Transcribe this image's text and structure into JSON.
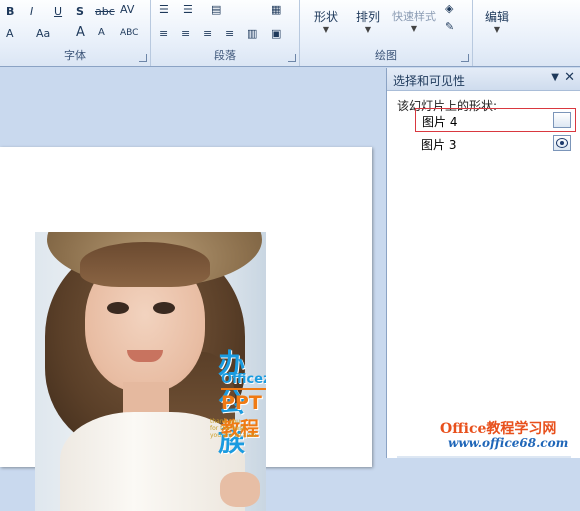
{
  "ribbon": {
    "font_group": {
      "label": "字体",
      "buttons": [
        "B",
        "I",
        "U",
        "S",
        "abc",
        "AV",
        "A",
        "Aa",
        "A",
        "A",
        "ABC"
      ]
    },
    "paragraph_group": {
      "label": "段落"
    },
    "drawing_group": {
      "label": "绘图",
      "shapes_label": "形状",
      "arrange_label": "排列",
      "quick_styles_label": "快速样式"
    },
    "editing_group": {
      "label": "编辑"
    }
  },
  "pane": {
    "title": "选择和可见性",
    "menu_glyph": "▼",
    "close_glyph": "✕",
    "subtitle": "该幻灯片上的形状:",
    "shapes": [
      {
        "name": "图片 4",
        "visible_icon": "visibility-toggle-icon"
      },
      {
        "name": "图片 3",
        "visible_icon": "eye-icon"
      }
    ]
  },
  "slide": {
    "watermark_logo": "办公族",
    "watermark_url": "Officezu.com",
    "watermark_ppt": "PPT教程",
    "watermark_small": [
      "thank you",
      "for the best",
      "you are so cute"
    ]
  },
  "site": {
    "name": "Office教程学习网",
    "url": "www.office68.com"
  },
  "colors": {
    "accent_blue": "#1a9be0",
    "accent_orange": "#f07a14",
    "selection_red": "#d9383f"
  }
}
